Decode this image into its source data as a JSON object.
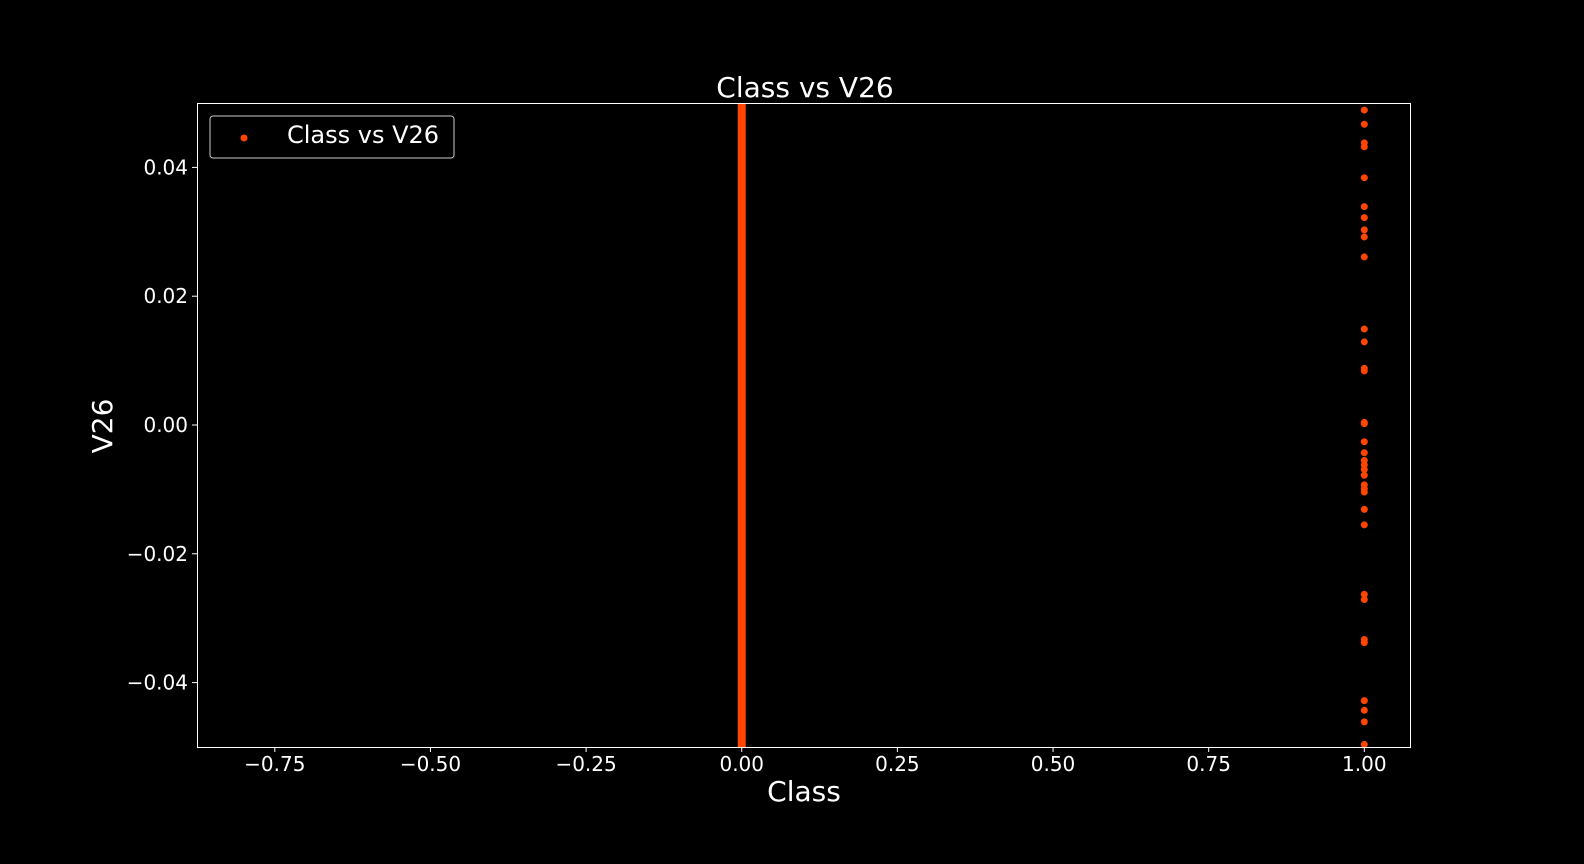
{
  "chart_data": {
    "type": "scatter",
    "title": "Class vs V26",
    "xlabel": "Class",
    "ylabel": "V26",
    "xlim": [
      -0.875,
      1.075
    ],
    "ylim": [
      -0.05,
      0.05
    ],
    "xticks": [
      {
        "value": -0.75,
        "label": "−0.75"
      },
      {
        "value": -0.5,
        "label": "−0.50"
      },
      {
        "value": -0.25,
        "label": "−0.25"
      },
      {
        "value": 0.0,
        "label": "0.00"
      },
      {
        "value": 0.25,
        "label": "0.25"
      },
      {
        "value": 0.5,
        "label": "0.50"
      },
      {
        "value": 0.75,
        "label": "0.75"
      },
      {
        "value": 1.0,
        "label": "1.00"
      }
    ],
    "yticks": [
      {
        "value": 0.04,
        "label": "0.04"
      },
      {
        "value": 0.02,
        "label": "0.02"
      },
      {
        "value": 0.0,
        "label": "0.00"
      },
      {
        "value": -0.02,
        "label": "−0.02"
      },
      {
        "value": -0.04,
        "label": "−0.04"
      }
    ],
    "grid": false,
    "legend": {
      "position": "upper-left",
      "entries": [
        "Class vs V26"
      ]
    },
    "colors": {
      "background": "#000000",
      "foreground": "#ffffff",
      "marker": "#ff4500"
    },
    "series": [
      {
        "name": "Class vs V26",
        "dense_band": {
          "x": 0.0,
          "y_range": [
            -0.05,
            0.05
          ]
        },
        "points": [
          [
            1.0,
            0.0489
          ],
          [
            1.0,
            0.0467
          ],
          [
            1.0,
            0.0438
          ],
          [
            1.0,
            0.0432
          ],
          [
            1.0,
            0.0384
          ],
          [
            1.0,
            0.0339
          ],
          [
            1.0,
            0.0322
          ],
          [
            1.0,
            0.0303
          ],
          [
            1.0,
            0.0292
          ],
          [
            1.0,
            0.0261
          ],
          [
            1.0,
            0.0149
          ],
          [
            1.0,
            0.0129
          ],
          [
            1.0,
            0.0088
          ],
          [
            1.0,
            0.0084
          ],
          [
            1.0,
            0.0004
          ],
          [
            1.0,
            0.0002
          ],
          [
            1.0,
            -0.0026
          ],
          [
            1.0,
            -0.0043
          ],
          [
            1.0,
            -0.0055
          ],
          [
            1.0,
            -0.0062
          ],
          [
            1.0,
            -0.0069
          ],
          [
            1.0,
            -0.0078
          ],
          [
            1.0,
            -0.0093
          ],
          [
            1.0,
            -0.0099
          ],
          [
            1.0,
            -0.0104
          ],
          [
            1.0,
            -0.0131
          ],
          [
            1.0,
            -0.0155
          ],
          [
            1.0,
            -0.0263
          ],
          [
            1.0,
            -0.0271
          ],
          [
            1.0,
            -0.0333
          ],
          [
            1.0,
            -0.0338
          ],
          [
            1.0,
            -0.0428
          ],
          [
            1.0,
            -0.0443
          ],
          [
            1.0,
            -0.0461
          ],
          [
            1.0,
            -0.0496
          ]
        ]
      }
    ]
  }
}
